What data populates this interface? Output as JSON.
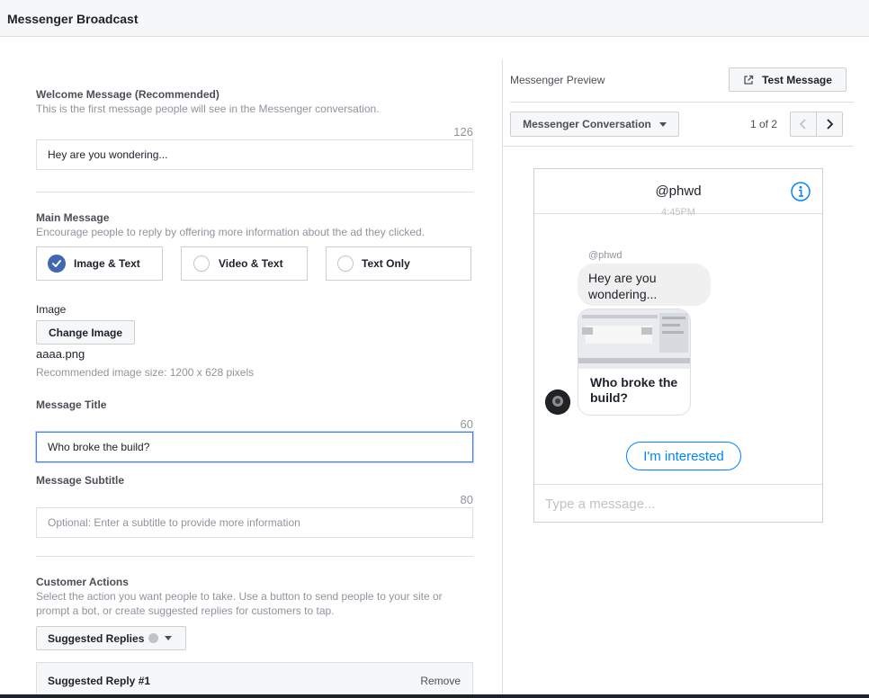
{
  "header": {
    "title": "Messenger Broadcast"
  },
  "welcome": {
    "label": "Welcome Message (Recommended)",
    "hint": "This is the first message people will see in the Messenger conversation.",
    "counter": "126",
    "value": "Hey are you wondering..."
  },
  "main_message": {
    "label": "Main Message",
    "hint": "Encourage people to reply by offering more information about the ad they clicked.",
    "options": [
      {
        "label": "Image & Text",
        "selected": true
      },
      {
        "label": "Video & Text",
        "selected": false
      },
      {
        "label": "Text Only",
        "selected": false
      }
    ]
  },
  "image": {
    "label": "Image",
    "change_button": "Change Image",
    "filename": "aaaa.png",
    "hint": "Recommended image size: 1200 x 628 pixels"
  },
  "title_field": {
    "label": "Message Title",
    "counter": "60",
    "value": "Who broke the build?"
  },
  "subtitle_field": {
    "label": "Message Subtitle",
    "counter": "80",
    "placeholder": "Optional: Enter a subtitle to provide more information"
  },
  "customer_actions": {
    "label": "Customer Actions",
    "hint_line1": "Select the action you want people to take. Use a button to send people to your site or",
    "hint_line2": "prompt a bot, or create suggested replies for customers to tap.",
    "dropdown": "Suggested Replies",
    "reply_title": "Suggested Reply #1",
    "remove": "Remove"
  },
  "preview": {
    "label": "Messenger Preview",
    "test_button": "Test Message",
    "conversation_dropdown": "Messenger Conversation",
    "pager": "1 of 2",
    "chat": {
      "page_name": "@phwd",
      "timestamp": "4:45PM",
      "sender": "@phwd",
      "message_line1": "Hey are you",
      "message_line2": "wondering...",
      "card_title_line1": "Who broke the",
      "card_title_line2": "build?",
      "quick_reply": "I'm interested",
      "composer_placeholder": "Type a message..."
    }
  },
  "colors": {
    "accent": "#4267b2",
    "focus": "#4080ff",
    "messenger_blue": "#0084ff",
    "border": "#dddfe2"
  }
}
